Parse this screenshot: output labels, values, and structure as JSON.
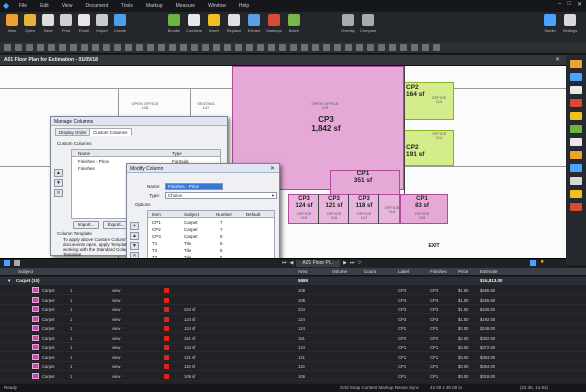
{
  "menu": {
    "items": [
      "File",
      "Edit",
      "View",
      "Document",
      "Tools",
      "Markup",
      "Measure",
      "Window",
      "Help"
    ]
  },
  "ribbon": {
    "left_labels": [
      "New",
      "Open",
      "Save",
      "Print",
      "Email",
      "Import",
      "Create"
    ],
    "mid_labels": [
      "Bundle",
      "Combine",
      "Insert",
      "Replace",
      "Extract",
      "Markups",
      "Batch"
    ],
    "right_labels": [
      "Overlay",
      "Compare"
    ],
    "far_labels": [
      "Studio",
      "Settings"
    ]
  },
  "document_tab": {
    "title": "A01 Floor Plan for Estimation - 01/09/18"
  },
  "plan": {
    "rooms": [
      {
        "name": "CP2",
        "area": "164 sf"
      },
      {
        "name": "CP3",
        "area": "1,842 sf"
      },
      {
        "name": "CP2",
        "area": "191 sf"
      },
      {
        "name": "CP1",
        "area": "351 sf"
      },
      {
        "name": "CP3",
        "area": "124 sf"
      },
      {
        "name": "CP3",
        "area": "121 sf"
      },
      {
        "name": "CP3",
        "area": "118 sf"
      },
      {
        "name": "CP1",
        "area": "83 sf"
      }
    ],
    "labels": {
      "open_office_1": "OPEN OFFICE",
      "open_office_1_num": "118",
      "seating": "SEATING",
      "seating_num": "147",
      "open_office_2": "OPEN OFFICE",
      "open_office_2_num": "129",
      "office_a": "OFFICE",
      "office_a_num": "113",
      "office_b": "OFFICE",
      "office_b_num": "114",
      "office_c": "OFFICE",
      "office_c_num": "115",
      "office_d": "OFFICE",
      "office_d_num": "116",
      "office_e": "OFFICE",
      "office_e_num": "117",
      "office_f": "OFFICE",
      "office_f_num": "118",
      "office_g": "OFFICE",
      "office_g_num": "119",
      "exit": "EXIT"
    }
  },
  "manage_columns": {
    "title": "Manage Columns",
    "tabs": [
      "Display Order",
      "Custom Columns"
    ],
    "section_label": "Custom Columns",
    "headers": [
      "Name",
      "Type"
    ],
    "rows": [
      {
        "name": "Finishes - Price",
        "type": "Formula"
      },
      {
        "name": "Finishes",
        "type": "Choice"
      }
    ],
    "import_label": "Import...",
    "export_label": "Export...",
    "template_title": "Column Template",
    "template_text": [
      "To apply above Custom Columns",
      "documents open, apply Template",
      "working with the Standard Colum",
      "Template."
    ]
  },
  "modify_column": {
    "title": "Modify Column",
    "name_label": "Name:",
    "name_value": "Finishes - Price",
    "type_label": "Type:",
    "type_value": "Choice",
    "options_label": "Options",
    "headers": [
      "Item",
      "Subject",
      "Number",
      "Default"
    ],
    "rows": [
      {
        "item": "CP1",
        "subject": "Carpet",
        "number": "7"
      },
      {
        "item": "CP2",
        "subject": "Carpet",
        "number": "7"
      },
      {
        "item": "CP3",
        "subject": "Carpet",
        "number": "8"
      },
      {
        "item": "T1",
        "subject": "Tile",
        "number": "6"
      },
      {
        "item": "T2",
        "subject": "Tile",
        "number": "5"
      },
      {
        "item": "T3",
        "subject": "Tile",
        "number": "5"
      }
    ],
    "import_label": "Import...",
    "export_label": "Export...",
    "ok_label": "OK",
    "cancel_label": "Cancel",
    "add_label": "Add",
    "delete_label": "Delete"
  },
  "page_nav": {
    "page_box": "A01 Floor Pl..."
  },
  "markups": {
    "columns": [
      "Subject",
      "Area",
      "Volume",
      "Count",
      "Label",
      "Finishes",
      "Price",
      "Estimate"
    ],
    "group": {
      "name": "Carpet (10)",
      "area": "5889",
      "total": "$16,813.00"
    },
    "rows": [
      {
        "subject": "Carpet",
        "n": "1",
        "layer": "view",
        "label_sf": "",
        "area": "108",
        "lbl": "CP3",
        "fin": "CP3",
        "price": "$1.50",
        "est": "$265.50"
      },
      {
        "subject": "Carpet",
        "n": "1",
        "layer": "view",
        "label_sf": "",
        "area": "108",
        "lbl": "CP3",
        "fin": "CP3",
        "price": "$1.50",
        "est": "$265.50"
      },
      {
        "subject": "Carpet",
        "n": "1",
        "layer": "view",
        "label_sf": "224 sf",
        "area": "224",
        "lbl": "CP3",
        "fin": "CP3",
        "price": "$1.50",
        "est": "$436.50"
      },
      {
        "subject": "Carpet",
        "n": "1",
        "layer": "view",
        "label_sf": "124 sf",
        "area": "124",
        "lbl": "CP3",
        "fin": "CP3",
        "price": "$1.50",
        "est": "$192.00"
      },
      {
        "subject": "Carpet",
        "n": "1",
        "layer": "view",
        "label_sf": "124 sf",
        "area": "124",
        "lbl": "CP2",
        "fin": "CP2",
        "price": "$2.00",
        "est": "$248.00"
      },
      {
        "subject": "Carpet",
        "n": "1",
        "layer": "view",
        "label_sf": "151 sf",
        "area": "151",
        "lbl": "CP2",
        "fin": "CP2",
        "price": "$2.00",
        "est": "$302.00"
      },
      {
        "subject": "Carpet",
        "n": "1",
        "layer": "view",
        "label_sf": "124 sf",
        "area": "124",
        "lbl": "CP1",
        "fin": "CP1",
        "price": "$3.00",
        "est": "$372.00"
      },
      {
        "subject": "Carpet",
        "n": "1",
        "layer": "view",
        "label_sf": "121 sf",
        "area": "121",
        "lbl": "CP1",
        "fin": "CP1",
        "price": "$3.00",
        "est": "$363.00"
      },
      {
        "subject": "Carpet",
        "n": "1",
        "layer": "view",
        "label_sf": "118 sf",
        "area": "118",
        "lbl": "CP1",
        "fin": "CP1",
        "price": "$3.00",
        "est": "$354.00"
      },
      {
        "subject": "Carpet",
        "n": "1",
        "layer": "view",
        "label_sf": "106 sf",
        "area": "106",
        "lbl": "CP1",
        "fin": "CP1",
        "price": "$3.00",
        "est": "$318.00"
      }
    ]
  },
  "status": {
    "ready": "Ready",
    "modes": "Grid  Snap  Content  Markup  Reuse  Sync",
    "size": "42.00 x 30.00 in",
    "coords": "(22.36, 14.82)"
  },
  "colors": {
    "carpet_fill": "#e5a8d7",
    "carpet_border": "#b24a9c",
    "tile_fill": "#d4ed8a",
    "accent": "#3875d7",
    "swatch": "#d8261e"
  }
}
